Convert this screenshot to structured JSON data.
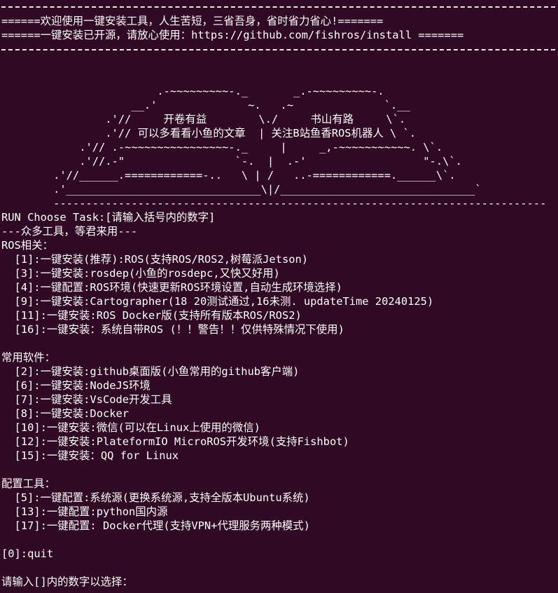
{
  "terminal": {
    "header": {
      "rule": "=======================================================================================================",
      "line1": "======欢迎使用一键安装工具，人生苦短，三省吾身，省时省力省心!=======",
      "line2": "======一键安装已开源，请放心使用：https://github.com/fishros/install ======="
    },
    "art": [
      "                        .-~~~~~~~~~-._       _.-~~~~~~~~~-.",
      "                    __.'              ~.   .~              `.__",
      "                .'//     开卷有益        \\./     书山有路     \\`.",
      "                .'// 可以多看看小鱼的文章  | 关注B站鱼香ROS机器人 \\ `.",
      "            .'// .-~~~~~~~~~~~~~~~~-._     |     _,-~~~~~~~~~~~. \\`.",
      "            .'//.-\"                 `-.  |  .-'                  \"-.\\`.",
      "        .'//______.============-..   \\ | /   ..-============.______\\`.",
      "        .'______________________________\\|/______________________________`",
      "        ----------------------------------------------------------------------------"
    ],
    "menu": {
      "prompt": "RUN Choose Task:[请输入括号内的数字]",
      "subtitle": "---众多工具，等君来用---",
      "sections": [
        {
          "title": "ROS相关：",
          "items": [
            "  [1]:一键安装(推荐):ROS(支持ROS/ROS2,树莓派Jetson)",
            "  [3]:一键安装:rosdep(小鱼的rosdepc,又快又好用)",
            "  [4]:一键配置:ROS环境(快速更新ROS环境设置,自动生成环境选择)",
            "  [9]:一键安装:Cartographer(18 20测试通过,16未测. updateTime 20240125)",
            "  [11]:一键安装:ROS Docker版(支持所有版本ROS/ROS2)",
            "  [16]:一键安装：系统自带ROS (！！警告！！仅供特殊情况下使用)"
          ]
        },
        {
          "title": "常用软件：",
          "items": [
            "  [2]:一键安装:github桌面版(小鱼常用的github客户端)",
            "  [6]:一键安装:NodeJS环境",
            "  [7]:一键安装:VsCode开发工具",
            "  [8]:一键安装:Docker",
            "  [10]:一键安装:微信(可以在Linux上使用的微信)",
            "  [12]:一键安装:PlateformIO MicroROS开发环境(支持Fishbot)",
            "  [15]:一键安装：QQ for Linux"
          ]
        },
        {
          "title": "配置工具：",
          "items": [
            "  [5]:一键配置:系统源(更换系统源,支持全版本Ubuntu系统)",
            "  [13]:一键配置:python国内源",
            "  [17]:一键配置: Docker代理(支持VPN+代理服务两种模式)"
          ]
        }
      ],
      "quit": "[0]:quit",
      "input_prompt": "请输入[]内的数字以选择："
    },
    "colors": {
      "background": "#300a24",
      "text": "#ffffff"
    }
  }
}
